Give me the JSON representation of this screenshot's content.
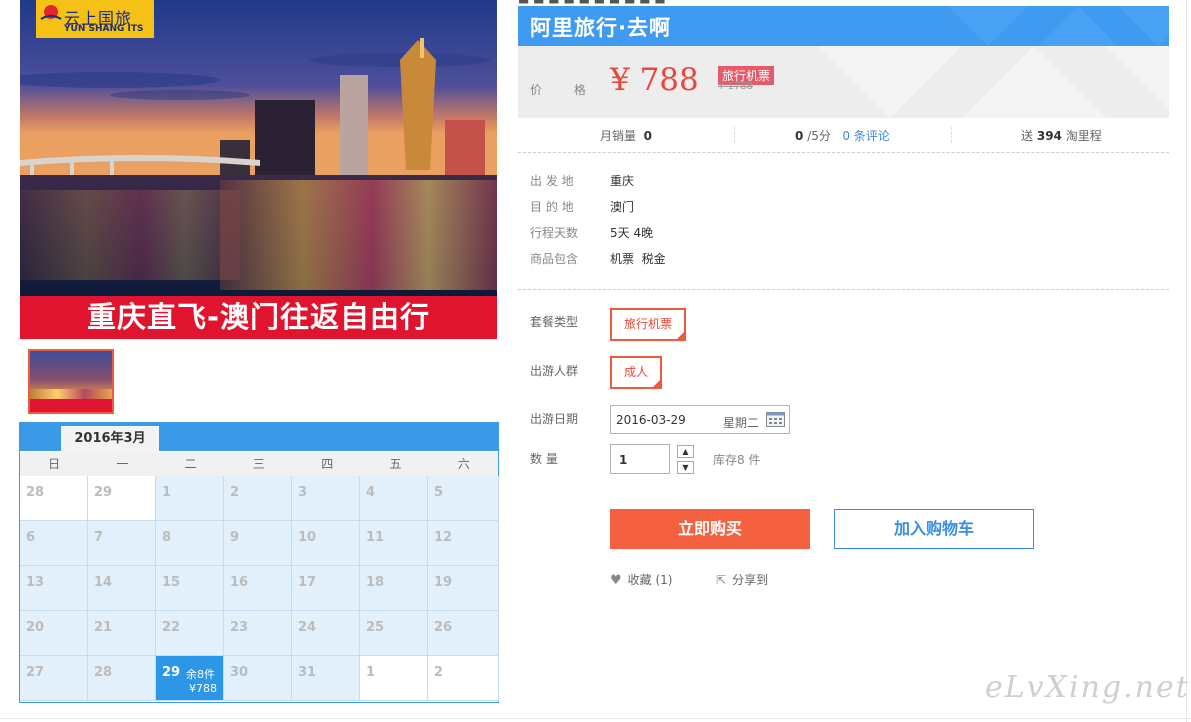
{
  "top_strip_text": "■ ■ ■ ■ ■ ■ ■ ■ ■ ■",
  "logo": {
    "name_cn": "云上国旅",
    "name_en": "YUN SHANG ITS"
  },
  "banner_text": "重庆直飞-澳门往返自由行",
  "product": {
    "title": "阿里旅行·去啊",
    "price_label": "价 格",
    "price": "¥ 788",
    "price_tag": "旅行机票",
    "original_price": "¥ 1788"
  },
  "stats": {
    "monthly_sales_label": "月销量",
    "monthly_sales": "0",
    "rating": "0",
    "rating_suffix": "/5分",
    "reviews_link": "0 条评论",
    "points_prefix": "送",
    "points": "394",
    "points_suffix": "淘里程"
  },
  "info": [
    {
      "label": "出 发 地",
      "value": "重庆"
    },
    {
      "label": "目 的 地",
      "value": "澳门"
    },
    {
      "label": "行程天数",
      "value": "5天 4晚"
    },
    {
      "label": "商品包含",
      "value": "机票  税金"
    }
  ],
  "options": {
    "package_label": "套餐类型",
    "package_value": "旅行机票",
    "group_label": "出游人群",
    "group_value": "成人",
    "date_label": "出游日期",
    "date_value": "2016-03-29",
    "weekday": "星期二",
    "qty_label": "数    量",
    "qty_value": "1",
    "stock": "库存8 件"
  },
  "actions": {
    "buy_now": "立即购买",
    "add_cart": "加入购物车",
    "favorite": "收藏 (1)",
    "share": "分享到"
  },
  "calendar": {
    "month_label": "2016年3月",
    "weekdays": [
      "日",
      "一",
      "二",
      "三",
      "四",
      "五",
      "六"
    ],
    "weeks": [
      [
        "28",
        "29",
        "1",
        "2",
        "3",
        "4",
        "5"
      ],
      [
        "6",
        "7",
        "8",
        "9",
        "10",
        "11",
        "12"
      ],
      [
        "13",
        "14",
        "15",
        "16",
        "17",
        "18",
        "19"
      ],
      [
        "20",
        "21",
        "22",
        "23",
        "24",
        "25",
        "26"
      ],
      [
        "27",
        "28",
        "29",
        "30",
        "31",
        "1",
        "2"
      ]
    ],
    "selected_stock": "余8件",
    "selected_price": "¥788"
  },
  "watermark": "eLvXing.net",
  "colors": {
    "accent_blue": "#3f9bf2",
    "price_red": "#e9473c",
    "buy_orange": "#f5613f",
    "banner_red": "#e0142e",
    "calendar_selected": "#2b97e6"
  }
}
